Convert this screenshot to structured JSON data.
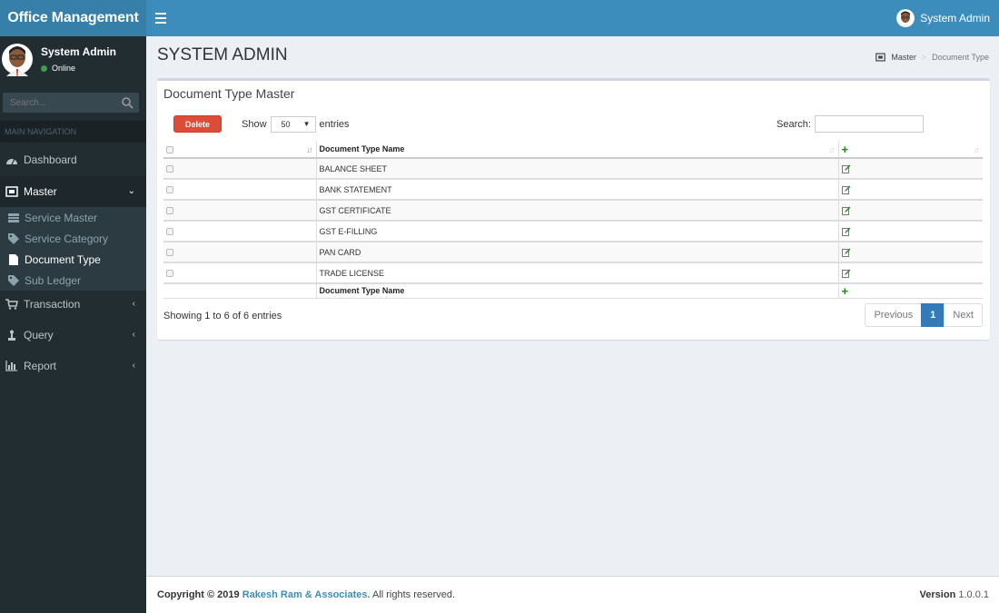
{
  "app": {
    "title": "Office Management"
  },
  "topbar": {
    "user_name": "System Admin",
    "menu_icon": "hamburger-icon"
  },
  "sidebar": {
    "user": {
      "name": "System Admin",
      "status": "Online",
      "status_color": "#3c9f4d"
    },
    "search": {
      "placeholder": "Search..."
    },
    "nav_header": "MAIN NAVIGATION",
    "items": [
      {
        "label": "Dashboard",
        "icon": "dashboard-icon"
      },
      {
        "label": "Master",
        "icon": "master-icon",
        "expanded": true
      },
      {
        "label": "Transaction",
        "icon": "cart-icon"
      },
      {
        "label": "Query",
        "icon": "query-icon"
      },
      {
        "label": "Report",
        "icon": "bar-chart-icon"
      }
    ],
    "master_submenu": [
      {
        "label": "Service Master",
        "icon": "list-icon"
      },
      {
        "label": "Service Category",
        "icon": "tag-icon"
      },
      {
        "label": "Document Type",
        "icon": "file-icon",
        "active": true
      },
      {
        "label": "Sub Ledger",
        "icon": "tag-icon"
      }
    ]
  },
  "content": {
    "header": "SYSTEM ADMIN",
    "breadcrumb": [
      "Master",
      "Document Type"
    ]
  },
  "box": {
    "title": "Document Type Master",
    "delete_label": "Delete",
    "show_label": "Show",
    "entries_label": "entries",
    "page_length": "50",
    "search_label": "Search:",
    "search_value": "",
    "table": {
      "columns": [
        "",
        "Document Type Name",
        "+"
      ],
      "rows": [
        {
          "name": "BALANCE SHEET"
        },
        {
          "name": "BANK STATEMENT"
        },
        {
          "name": "GST CERTIFICATE"
        },
        {
          "name": "GST E-FILLING"
        },
        {
          "name": "PAN CARD"
        },
        {
          "name": "TRADE LICENSE"
        }
      ],
      "footer": [
        "",
        "Document Type Name",
        "+"
      ]
    },
    "info": "Showing 1 to 6 of 6 entries",
    "pagination": {
      "previous": "Previous",
      "current": "1",
      "next": "Next"
    }
  },
  "colors": {
    "header_bg": "#3c8dbc",
    "logo_bg": "#367fa9",
    "sidebar_bg": "#222d32",
    "delete_btn": "#dd4b39",
    "page_active": "#337ab7",
    "plus_green": "#1a8a1a"
  },
  "footer": {
    "copyright_prefix": "Copyright © 2019",
    "company": "Rakesh Ram & Associates.",
    "suffix": "All rights reserved.",
    "version_label": "Version",
    "version": "1.0.0.1"
  }
}
